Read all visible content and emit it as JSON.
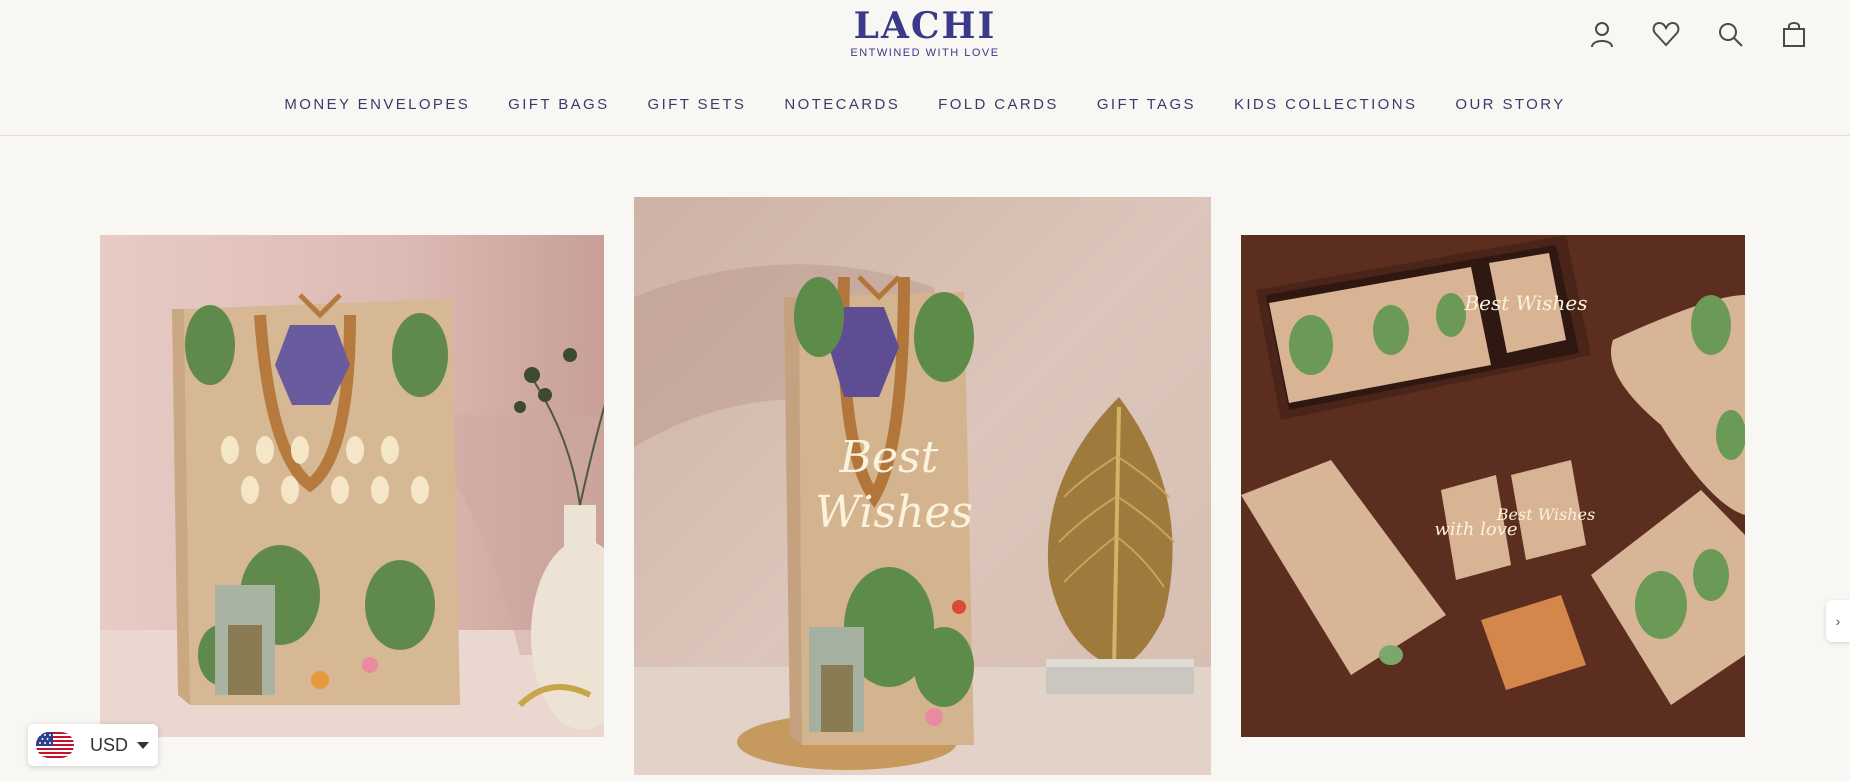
{
  "brand": {
    "name": "LACHI",
    "tagline": "ENTWINED WITH LOVE"
  },
  "header_icons": [
    "account-icon",
    "heart-icon",
    "search-icon",
    "shopping-bag-icon"
  ],
  "nav": {
    "items": [
      {
        "label": "MONEY ENVELOPES"
      },
      {
        "label": "GIFT BAGS"
      },
      {
        "label": "GIFT SETS"
      },
      {
        "label": "NOTECARDS"
      },
      {
        "label": "FOLD CARDS"
      },
      {
        "label": "GIFT TAGS"
      },
      {
        "label": "KIDS COLLECTIONS"
      },
      {
        "label": "OUR STORY"
      }
    ]
  },
  "gallery": {
    "tile_1": {
      "text": ""
    },
    "tile_2": {
      "text": "Best Wishes"
    },
    "tile_3": {
      "tag_1": "Best Wishes",
      "tag_2": "with love",
      "tag_3": "Best Wishes"
    }
  },
  "currency": {
    "code": "USD",
    "flag": "us-flag-icon"
  },
  "side_tab": {
    "icon": "chevron-right-icon",
    "glyph": "›"
  },
  "colors": {
    "background": "#f9f7f3",
    "brand": "#3b3a8a",
    "nav_text": "#3d3a6b"
  }
}
